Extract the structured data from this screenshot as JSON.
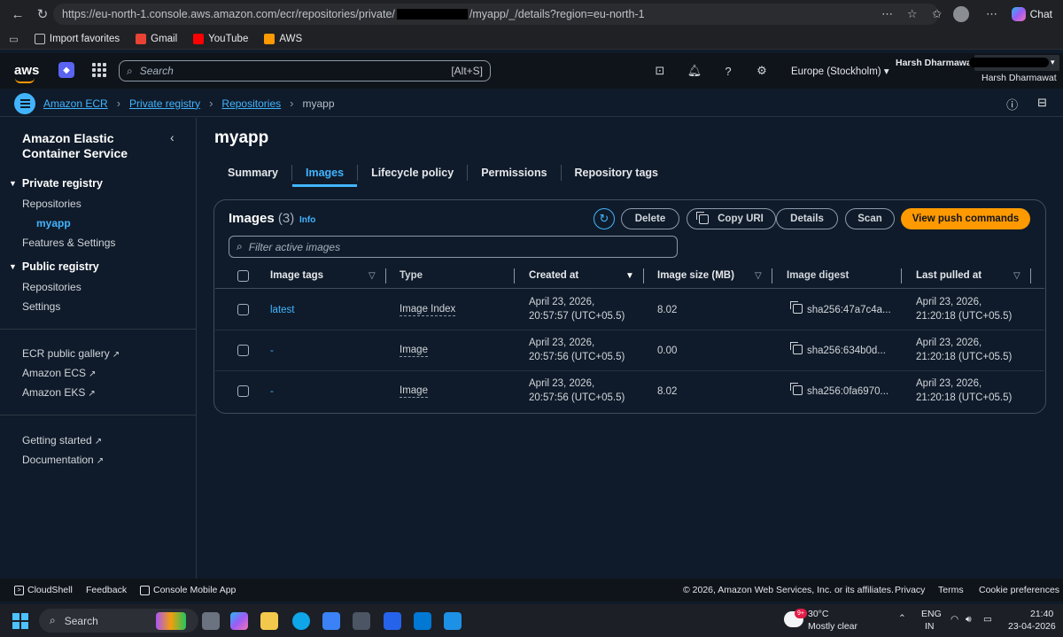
{
  "browser": {
    "url_prefix": "https://eu-north-1.console.aws.amazon.com/ecr/repositories/private/",
    "url_suffix": "/myapp/_/details?region=eu-north-1",
    "chat_label": "Chat",
    "bookmarks": [
      "Import favorites",
      "Gmail",
      "YouTube",
      "AWS"
    ]
  },
  "aws_nav": {
    "logo": "aws",
    "search_placeholder": "Search",
    "search_shortcut": "[Alt+S]",
    "region": "Europe (Stockholm)",
    "user_name": "Harsh Dharmawat",
    "user_top": "Harsh Dharmawat"
  },
  "breadcrumb": [
    "Amazon ECR",
    "Private registry",
    "Repositories",
    "myapp"
  ],
  "sidebar": {
    "title": "Amazon Elastic Container Service",
    "private_registry": "Private registry",
    "private_items": [
      "Repositories",
      "myapp",
      "Features & Settings"
    ],
    "public_registry": "Public registry",
    "public_items": [
      "Repositories",
      "Settings"
    ],
    "external_links": [
      "ECR public gallery",
      "Amazon ECS",
      "Amazon EKS"
    ],
    "help_links": [
      "Getting started",
      "Documentation"
    ]
  },
  "page": {
    "title": "myapp",
    "tabs": [
      "Summary",
      "Images",
      "Lifecycle policy",
      "Permissions",
      "Repository tags"
    ],
    "active_tab": "Images"
  },
  "images_panel": {
    "title": "Images",
    "count": "(3)",
    "info": "Info",
    "buttons": {
      "delete": "Delete",
      "copy_uri": "Copy URI",
      "details": "Details",
      "scan": "Scan",
      "push": "View push commands"
    },
    "filter_placeholder": "Filter active images",
    "columns": [
      "Image tags",
      "Type",
      "Created at",
      "Image size (MB)",
      "Image digest",
      "Last pulled at"
    ],
    "rows": [
      {
        "tag": "latest",
        "type": "Image Index",
        "created_date": "April 23, 2026,",
        "created_time": "20:57:57 (UTC+05.5)",
        "size": "8.02",
        "digest": "sha256:47a7c4a...",
        "pulled_date": "April 23, 2026,",
        "pulled_time": "21:20:18 (UTC+05.5)"
      },
      {
        "tag": "-",
        "type": "Image",
        "created_date": "April 23, 2026,",
        "created_time": "20:57:56 (UTC+05.5)",
        "size": "0.00",
        "digest": "sha256:634b0d...",
        "pulled_date": "April 23, 2026,",
        "pulled_time": "21:20:18 (UTC+05.5)"
      },
      {
        "tag": "-",
        "type": "Image",
        "created_date": "April 23, 2026,",
        "created_time": "20:57:56 (UTC+05.5)",
        "size": "8.02",
        "digest": "sha256:0fa6970...",
        "pulled_date": "April 23, 2026,",
        "pulled_time": "21:20:18 (UTC+05.5)"
      }
    ]
  },
  "footer": {
    "cloudshell": "CloudShell",
    "feedback": "Feedback",
    "mobile_app": "Console Mobile App",
    "copyright": "© 2026, Amazon Web Services, Inc. or its affiliates.",
    "privacy": "Privacy",
    "terms": "Terms",
    "cookies": "Cookie preferences"
  },
  "taskbar": {
    "search": "Search",
    "temperature": "30°C",
    "weather": "Mostly clear",
    "badge": "9+",
    "lang_top": "ENG",
    "lang_bottom": "IN",
    "time": "21:40",
    "date": "23-04-2026"
  }
}
